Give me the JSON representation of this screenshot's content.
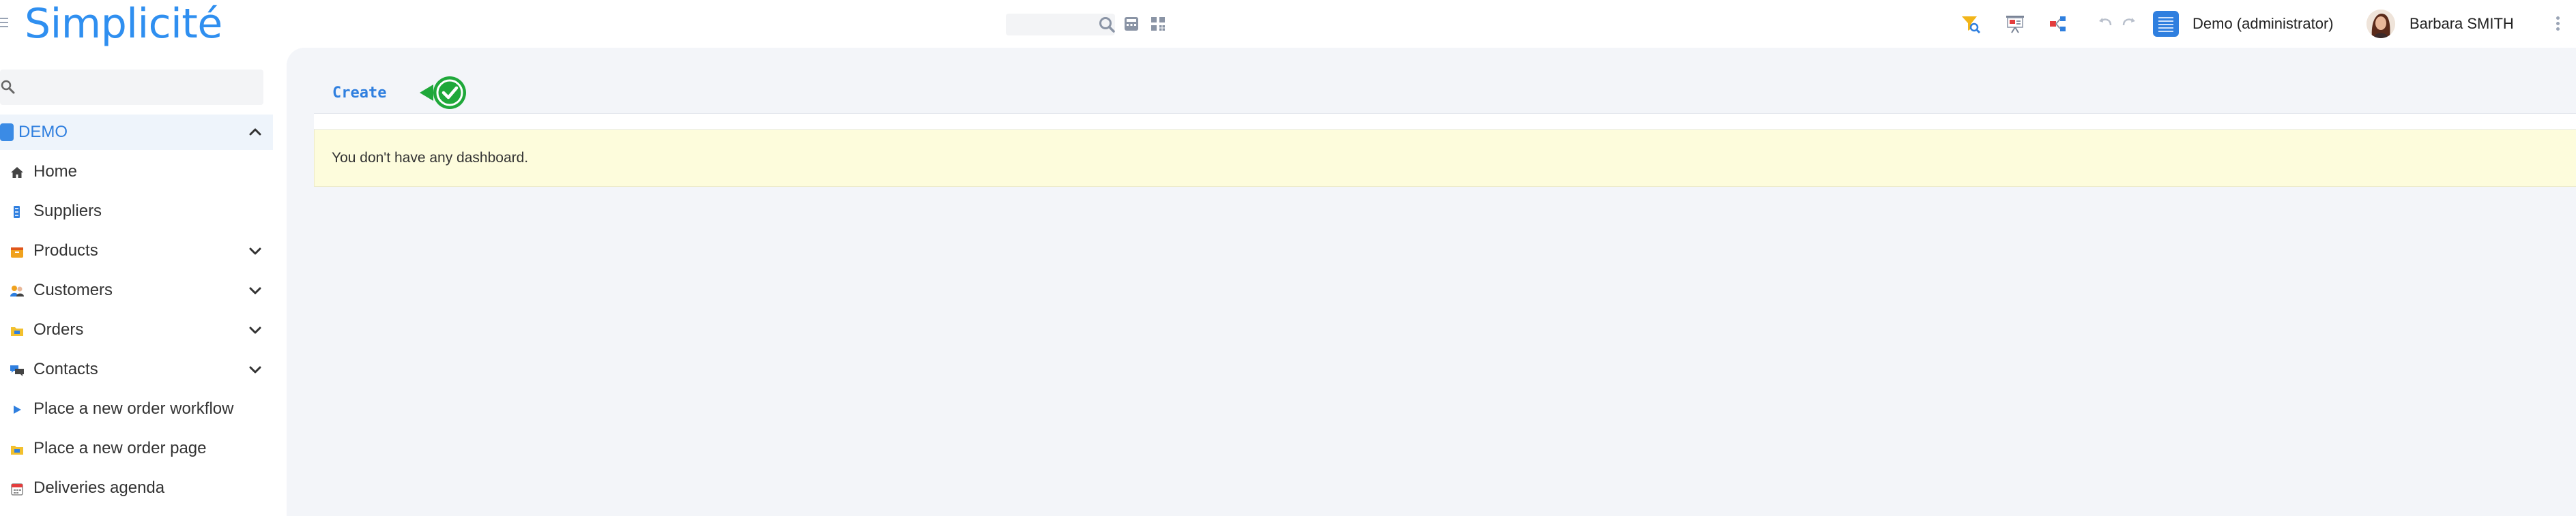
{
  "app": {
    "logo_text": "Simplicité",
    "brand_color": "#2f8ff0",
    "accent_color": "#2f7fdf",
    "success_color": "#1fa83a"
  },
  "header": {
    "search_placeholder": "",
    "icons": [
      "menu-icon",
      "search-icon",
      "calculator-icon",
      "grid-icon",
      "filter-search-icon",
      "presentation-icon",
      "share-nodes-icon",
      "undo-icon",
      "redo-icon",
      "more-vertical-icon"
    ],
    "scope_label": "Demo (administrator)",
    "user_label": "Barbara SMITH"
  },
  "sidebar": {
    "search_placeholder": "",
    "module": {
      "label": "DEMO",
      "expanded": true
    },
    "items": [
      {
        "label": "Home",
        "icon": "home-icon",
        "has_children": false
      },
      {
        "label": "Suppliers",
        "icon": "supplier-icon",
        "has_children": false
      },
      {
        "label": "Products",
        "icon": "product-box-icon",
        "has_children": true
      },
      {
        "label": "Customers",
        "icon": "customers-icon",
        "has_children": true
      },
      {
        "label": "Orders",
        "icon": "orders-folder-icon",
        "has_children": true
      },
      {
        "label": "Contacts",
        "icon": "contacts-chat-icon",
        "has_children": true
      },
      {
        "label": "Place a new order workflow",
        "icon": "play-icon",
        "has_children": false
      },
      {
        "label": "Place a new order page",
        "icon": "orders-folder-icon",
        "has_children": false
      },
      {
        "label": "Deliveries agenda",
        "icon": "calendar-icon",
        "has_children": false
      }
    ]
  },
  "main": {
    "create_label": "Create",
    "notice_text": "You don't have any dashboard."
  }
}
